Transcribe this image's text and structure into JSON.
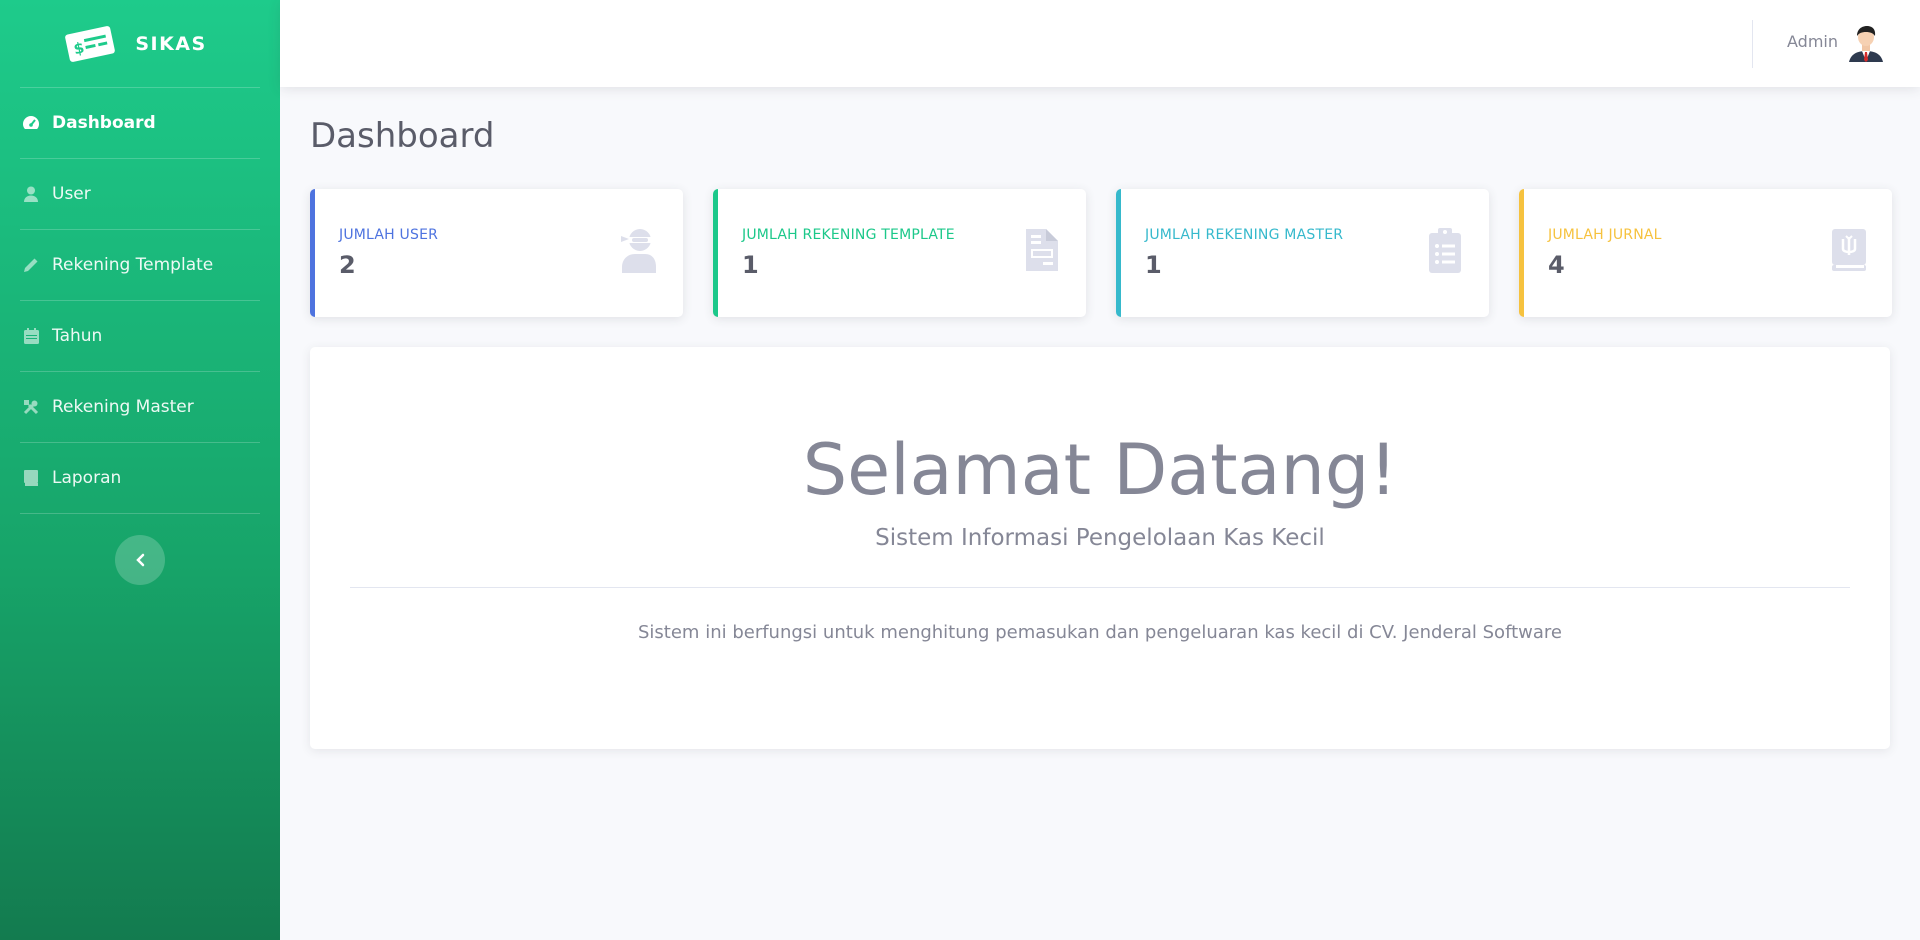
{
  "brand": {
    "name": "SIKAS",
    "logo_icon": "money-check-icon"
  },
  "sidebar": {
    "items": [
      {
        "label": "Dashboard",
        "icon": "tachometer-icon",
        "active": true
      },
      {
        "label": "User",
        "icon": "user-icon",
        "active": false
      },
      {
        "label": "Rekening Template",
        "icon": "pencil-icon",
        "active": false
      },
      {
        "label": "Tahun",
        "icon": "calendar-icon",
        "active": false
      },
      {
        "label": "Rekening Master",
        "icon": "tools-icon",
        "active": false
      },
      {
        "label": "Laporan",
        "icon": "book-icon",
        "active": false
      }
    ],
    "toggle_icon": "chevron-left-icon"
  },
  "topbar": {
    "user_name": "Admin",
    "avatar_icon": "user-avatar"
  },
  "page": {
    "title": "Dashboard"
  },
  "cards": [
    {
      "label": "JUMLAH USER",
      "value": "2",
      "color": "#4e73df",
      "icon": "user-ninja-icon"
    },
    {
      "label": "JUMLAH REKENING TEMPLATE",
      "value": "1",
      "color": "#1cc88a",
      "icon": "file-invoice-icon"
    },
    {
      "label": "JUMLAH REKENING MASTER",
      "value": "1",
      "color": "#36b9cc",
      "icon": "clipboard-list-icon"
    },
    {
      "label": "JUMLAH JURNAL",
      "value": "4",
      "color": "#f6c23e",
      "icon": "journal-icon"
    }
  ],
  "welcome": {
    "heading": "Selamat Datang!",
    "lead": "Sistem Informasi Pengelolaan Kas Kecil",
    "description": "Sistem ini berfungsi untuk menghitung pemasukan dan pengeluaran kas kecil di CV. Jenderal Software"
  },
  "colors": {
    "sidebar_top": "#1ecb8b",
    "sidebar_bottom": "#137b4f",
    "icon_gray": "#dddfeb"
  }
}
